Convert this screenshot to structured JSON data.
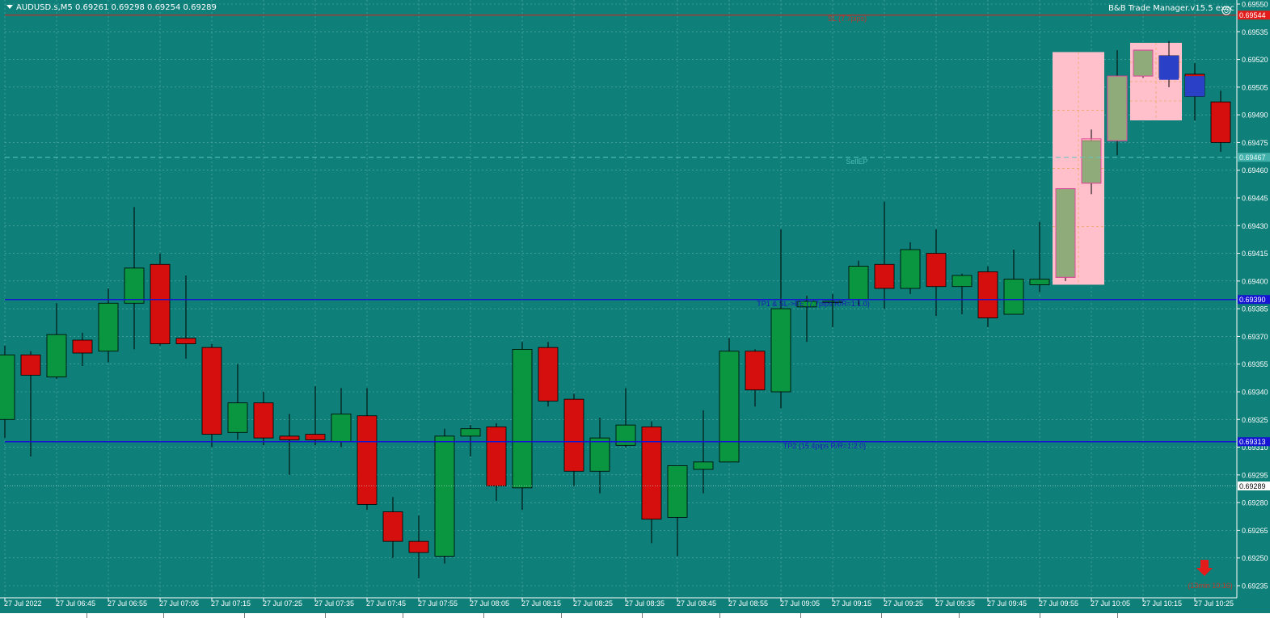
{
  "header": {
    "symbol_info": "AUDUSD.s,M5  0.69261 0.69298 0.69254 0.69289",
    "trade_manager": "B&B Trade Manager.v15.5 exec"
  },
  "levels": {
    "sl_label": "SL (7.7pips)",
    "sl_price": "0.69544",
    "sell_ep_label": "SellEP",
    "sell_ep_price": "0.69467",
    "tp1_label": "TP1 & SL->BE (7.7pips R/R=1:1.0)",
    "tp1_price": "0.69390",
    "tp2_label": "TP2 (15.4pips R/R=1:2.0)",
    "tp2_price": "0.69313",
    "bid_price": "0.69289",
    "countdown": "(13min 10:16)"
  },
  "colors": {
    "background": "#0e7f79",
    "grid": "#5fb3a9",
    "bull": "#0a9641",
    "bear": "#d50e0e",
    "sl_line": "#e41b1b",
    "tp_line": "#1414d2",
    "zone": "#ffc0cb",
    "marker_blue": "#2940c7"
  },
  "icons": {
    "countdown_arrow": "down-arrow-icon"
  },
  "chart_data": {
    "type": "candlestick",
    "symbol": "AUDUSD.s",
    "timeframe": "M5",
    "y_ticks": [
      "0.69550",
      "0.69535",
      "0.69520",
      "0.69505",
      "0.69490",
      "0.69475",
      "0.69460",
      "0.69445",
      "0.69430",
      "0.69415",
      "0.69400",
      "0.69385",
      "0.69370",
      "0.69355",
      "0.69340",
      "0.69325",
      "0.69310",
      "0.69295",
      "0.69280",
      "0.69265",
      "0.69250",
      "0.69235"
    ],
    "ylim": [
      0.69228,
      0.69556
    ],
    "x_labels": [
      {
        "i": 0,
        "t": "27 Jul 2022"
      },
      {
        "i": 2,
        "t": "27 Jul 06:45"
      },
      {
        "i": 4,
        "t": "27 Jul 06:55"
      },
      {
        "i": 6,
        "t": "27 Jul 07:05"
      },
      {
        "i": 8,
        "t": "27 Jul 07:15"
      },
      {
        "i": 10,
        "t": "27 Jul 07:25"
      },
      {
        "i": 12,
        "t": "27 Jul 07:35"
      },
      {
        "i": 14,
        "t": "27 Jul 07:45"
      },
      {
        "i": 16,
        "t": "27 Jul 07:55"
      },
      {
        "i": 18,
        "t": "27 Jul 08:05"
      },
      {
        "i": 20,
        "t": "27 Jul 08:15"
      },
      {
        "i": 22,
        "t": "27 Jul 08:25"
      },
      {
        "i": 24,
        "t": "27 Jul 08:35"
      },
      {
        "i": 26,
        "t": "27 Jul 08:45"
      },
      {
        "i": 28,
        "t": "27 Jul 08:55"
      },
      {
        "i": 30,
        "t": "27 Jul 09:05"
      },
      {
        "i": 32,
        "t": "27 Jul 09:15"
      },
      {
        "i": 34,
        "t": "27 Jul 09:25"
      },
      {
        "i": 36,
        "t": "27 Jul 09:35"
      },
      {
        "i": 38,
        "t": "27 Jul 09:45"
      },
      {
        "i": 40,
        "t": "27 Jul 09:55"
      },
      {
        "i": 42,
        "t": "27 Jul 10:05"
      },
      {
        "i": 44,
        "t": "27 Jul 10:15"
      },
      {
        "i": 46,
        "t": "27 Jul 10:25"
      }
    ],
    "candles": [
      {
        "o": 0.69325,
        "h": 0.69365,
        "l": 0.69315,
        "c": 0.6936
      },
      {
        "o": 0.6936,
        "h": 0.69362,
        "l": 0.69305,
        "c": 0.69349
      },
      {
        "o": 0.69348,
        "h": 0.69388,
        "l": 0.69347,
        "c": 0.69371
      },
      {
        "o": 0.69368,
        "h": 0.69372,
        "l": 0.69354,
        "c": 0.69361
      },
      {
        "o": 0.69362,
        "h": 0.69396,
        "l": 0.69356,
        "c": 0.69388
      },
      {
        "o": 0.69388,
        "h": 0.6944,
        "l": 0.69363,
        "c": 0.69407
      },
      {
        "o": 0.69409,
        "h": 0.69415,
        "l": 0.69365,
        "c": 0.69366
      },
      {
        "o": 0.69369,
        "h": 0.69403,
        "l": 0.69358,
        "c": 0.69366
      },
      {
        "o": 0.69364,
        "h": 0.69366,
        "l": 0.6931,
        "c": 0.69317
      },
      {
        "o": 0.69318,
        "h": 0.69355,
        "l": 0.69314,
        "c": 0.69334
      },
      {
        "o": 0.69334,
        "h": 0.6934,
        "l": 0.69311,
        "c": 0.69315
      },
      {
        "o": 0.69316,
        "h": 0.69328,
        "l": 0.69295,
        "c": 0.69314
      },
      {
        "o": 0.69317,
        "h": 0.69343,
        "l": 0.69311,
        "c": 0.69314
      },
      {
        "o": 0.69313,
        "h": 0.69342,
        "l": 0.6931,
        "c": 0.69328
      },
      {
        "o": 0.69327,
        "h": 0.69342,
        "l": 0.69276,
        "c": 0.69279
      },
      {
        "o": 0.69275,
        "h": 0.69283,
        "l": 0.6925,
        "c": 0.69259
      },
      {
        "o": 0.69259,
        "h": 0.69273,
        "l": 0.69239,
        "c": 0.69253
      },
      {
        "o": 0.69251,
        "h": 0.6932,
        "l": 0.69247,
        "c": 0.69316
      },
      {
        "o": 0.69316,
        "h": 0.69322,
        "l": 0.69305,
        "c": 0.6932
      },
      {
        "o": 0.69321,
        "h": 0.69323,
        "l": 0.69281,
        "c": 0.69289
      },
      {
        "o": 0.69288,
        "h": 0.69367,
        "l": 0.69276,
        "c": 0.69363
      },
      {
        "o": 0.69364,
        "h": 0.69367,
        "l": 0.69332,
        "c": 0.69335
      },
      {
        "o": 0.69336,
        "h": 0.69339,
        "l": 0.69289,
        "c": 0.69297
      },
      {
        "o": 0.69297,
        "h": 0.69326,
        "l": 0.69285,
        "c": 0.69315
      },
      {
        "o": 0.69311,
        "h": 0.69342,
        "l": 0.6931,
        "c": 0.69322
      },
      {
        "o": 0.69321,
        "h": 0.69324,
        "l": 0.69258,
        "c": 0.69271
      },
      {
        "o": 0.69272,
        "h": 0.693,
        "l": 0.69251,
        "c": 0.693
      },
      {
        "o": 0.69298,
        "h": 0.6933,
        "l": 0.69285,
        "c": 0.69302
      },
      {
        "o": 0.69302,
        "h": 0.69369,
        "l": 0.69302,
        "c": 0.69362
      },
      {
        "o": 0.69362,
        "h": 0.69363,
        "l": 0.69332,
        "c": 0.69341
      },
      {
        "o": 0.6934,
        "h": 0.69428,
        "l": 0.69331,
        "c": 0.69385
      },
      {
        "o": 0.69386,
        "h": 0.69392,
        "l": 0.69367,
        "c": 0.69389
      },
      {
        "o": 0.69389,
        "h": 0.69393,
        "l": 0.69375,
        "c": 0.69389
      },
      {
        "o": 0.6939,
        "h": 0.69411,
        "l": 0.69387,
        "c": 0.69408
      },
      {
        "o": 0.69409,
        "h": 0.69443,
        "l": 0.69385,
        "c": 0.69396
      },
      {
        "o": 0.69396,
        "h": 0.69421,
        "l": 0.69393,
        "c": 0.69417
      },
      {
        "o": 0.69415,
        "h": 0.69428,
        "l": 0.69381,
        "c": 0.69397
      },
      {
        "o": 0.69397,
        "h": 0.69404,
        "l": 0.69382,
        "c": 0.69403
      },
      {
        "o": 0.69405,
        "h": 0.69408,
        "l": 0.69375,
        "c": 0.6938
      },
      {
        "o": 0.69382,
        "h": 0.69417,
        "l": 0.69382,
        "c": 0.69401
      },
      {
        "o": 0.69398,
        "h": 0.69432,
        "l": 0.69394,
        "c": 0.69401
      },
      {
        "o": 0.69402,
        "h": 0.6945,
        "l": 0.694,
        "c": 0.6945
      },
      {
        "o": 0.69453,
        "h": 0.69482,
        "l": 0.69447,
        "c": 0.69476
      },
      {
        "o": 0.69476,
        "h": 0.69525,
        "l": 0.69468,
        "c": 0.69511
      },
      {
        "o": 0.69511,
        "h": 0.69525,
        "l": 0.6951,
        "c": 0.69525
      },
      {
        "o": 0.69522,
        "h": 0.6953,
        "l": 0.69505,
        "c": 0.6951
      },
      {
        "o": 0.69512,
        "h": 0.69518,
        "l": 0.69487,
        "c": 0.695
      },
      {
        "o": 0.69497,
        "h": 0.69503,
        "l": 0.6947,
        "c": 0.69475
      }
    ],
    "zones": [
      {
        "from": 41,
        "to": 42,
        "high": 0.69524,
        "low": 0.69398
      },
      {
        "from": 44,
        "to": 45,
        "high": 0.69529,
        "low": 0.69487
      }
    ],
    "overlays": [
      {
        "i": 41,
        "o": 0.6945,
        "c": 0.69402,
        "style": "salmon"
      },
      {
        "i": 42,
        "o": 0.69477,
        "c": 0.69453,
        "style": "salmon"
      },
      {
        "i": 43,
        "o": 0.69511,
        "c": 0.69476,
        "style": "salmon"
      },
      {
        "i": 44,
        "o": 0.69525,
        "c": 0.69511,
        "style": "salmon"
      },
      {
        "i": 45,
        "o": 0.69522,
        "c": 0.69509,
        "style": "blue"
      },
      {
        "i": 46,
        "o": 0.69511,
        "c": 0.695,
        "style": "blue"
      }
    ]
  }
}
